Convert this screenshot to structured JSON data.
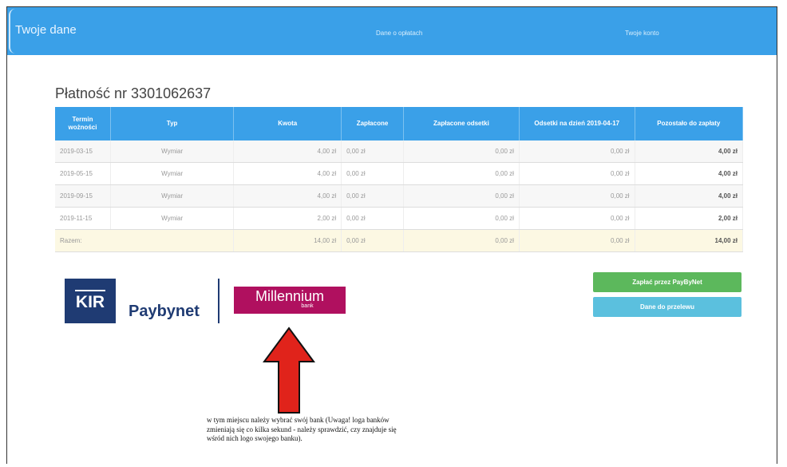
{
  "header": {
    "brand": "Twoje dane",
    "nav": [
      "Dane o opłatach",
      "Twoje konto"
    ]
  },
  "payment": {
    "title": "Płatność nr 3301062637",
    "columns": [
      "Termin wożności",
      "Typ",
      "Kwota",
      "Zapłacone",
      "Zapłacone odsetki",
      "Odsetki na dzień 2019-04-17",
      "Pozostało do zapłaty"
    ],
    "rows": [
      [
        "2019-03-15",
        "Wymiar",
        "4,00 zł",
        "0,00 zł",
        "0,00 zł",
        "0,00 zł",
        "4,00 zł"
      ],
      [
        "2019-05-15",
        "Wymiar",
        "4,00 zł",
        "0,00 zł",
        "0,00 zł",
        "0,00 zł",
        "4,00 zł"
      ],
      [
        "2019-09-15",
        "Wymiar",
        "4,00 zł",
        "0,00 zł",
        "0,00 zł",
        "0,00 zł",
        "4,00 zł"
      ],
      [
        "2019-11-15",
        "Wymiar",
        "2,00 zł",
        "0,00 zł",
        "0,00 zł",
        "0,00 zł",
        "2,00 zł"
      ]
    ],
    "summary": [
      "Razem:",
      "14,00 zł",
      "0,00 zł",
      "0,00 zł",
      "0,00 zł",
      "14,00 zł"
    ]
  },
  "buttons": {
    "pay": "Zapłać przez PayByNet",
    "transfer": "Dane do przelewu"
  },
  "logos": {
    "kir": "KIR",
    "paybynet": "Paybynet",
    "millennium": "Millennium",
    "millennium_sub": "bank"
  },
  "annotation": {
    "text": "w tym miejscu należy wybrać swój bank (Uwaga! loga banków zmieniają się co kilka sekund - należy sprawdzić, czy znajduje się wśród nich logo swojego banku).",
    "arrow_color": "#e0231b"
  },
  "colors": {
    "header": "#3aa0e8",
    "pay_button": "#5cb85c",
    "transfer_button": "#5bc0de",
    "kir": "#1f3b73",
    "millennium": "#b0105f"
  }
}
